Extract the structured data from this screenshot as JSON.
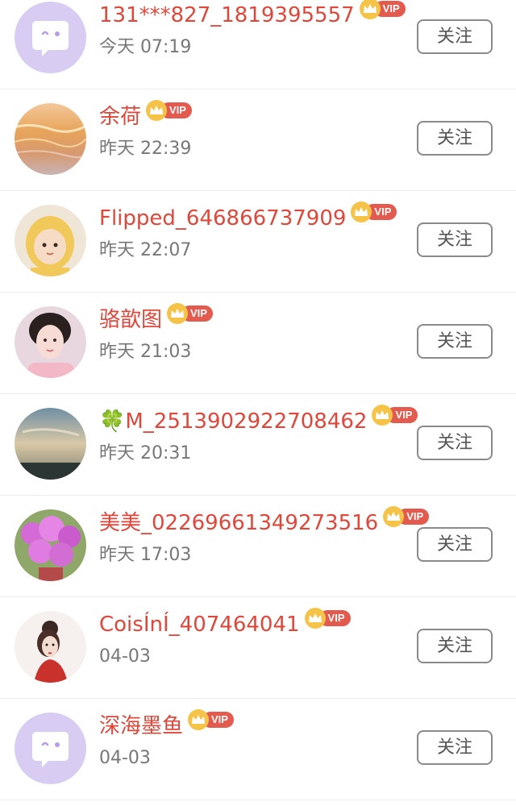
{
  "colors": {
    "username": "#e0473a",
    "vip_pill": "#e35a4f",
    "vip_crown": "#f5c347",
    "time_text": "#777777",
    "button_border": "#8a8a8a",
    "divider": "#ececec"
  },
  "users": [
    {
      "name": "131***827_1819395557",
      "time": "今天 07:19",
      "vip": "VIP",
      "button": "关注",
      "avatar": "default-chat-bubble-avatar"
    },
    {
      "name": "余荷",
      "time": "昨天 22:39",
      "vip": "VIP",
      "button": "关注",
      "avatar": "golden-water-photo-avatar"
    },
    {
      "name": "Flipped_646866737909",
      "time": "昨天 22:07",
      "vip": "VIP",
      "button": "关注",
      "avatar": "child-in-yellow-hood-avatar"
    },
    {
      "name": "骆歆图",
      "time": "昨天 21:03",
      "vip": "VIP",
      "button": "关注",
      "avatar": "girl-portrait-avatar"
    },
    {
      "name": "🍀M_2513902922708462",
      "time": "昨天 20:31",
      "vip": "VIP",
      "button": "关注",
      "avatar": "sunset-landscape-avatar"
    },
    {
      "name": "美美_02269661349273516",
      "time": "昨天 17:03",
      "vip": "VIP",
      "button": "关注",
      "avatar": "pink-flowers-avatar"
    },
    {
      "name": "CoisÍnÍ_407464041",
      "time": "04-03",
      "vip": "VIP",
      "button": "关注",
      "avatar": "illustrated-woman-avatar"
    },
    {
      "name": "深海墨鱼",
      "time": "04-03",
      "vip": "VIP",
      "button": "关注",
      "avatar": "default-chat-bubble-avatar"
    }
  ]
}
